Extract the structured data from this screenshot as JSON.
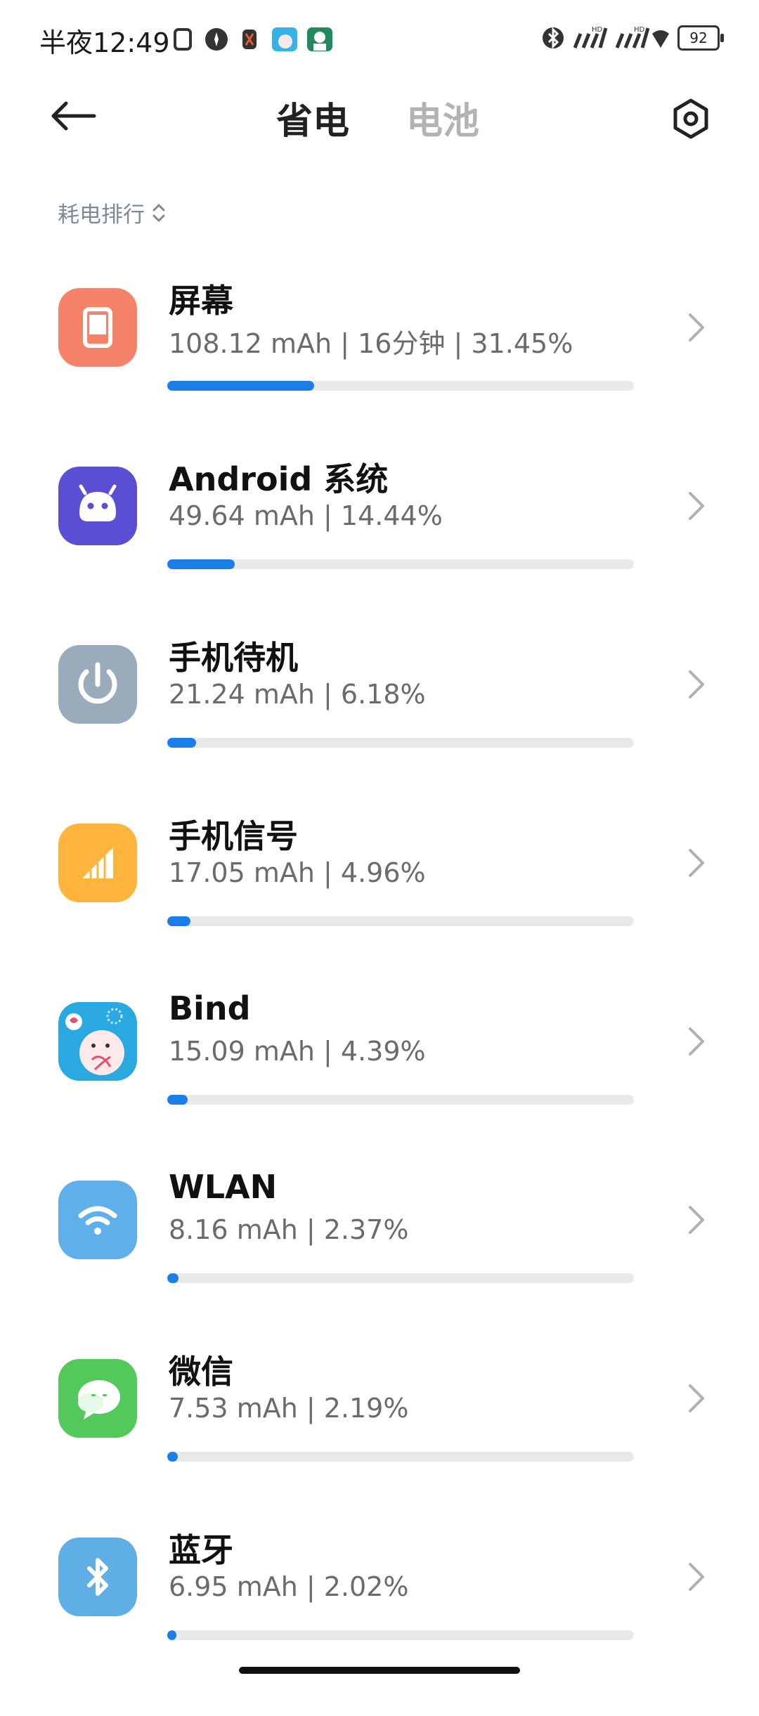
{
  "status_bar": {
    "time": "半夜12:49",
    "battery": "92"
  },
  "header": {
    "tab_active": "省电",
    "tab_inactive": "电池",
    "icons": [
      "back-arrow-icon",
      "settings-hexagon-icon"
    ]
  },
  "sort": {
    "label": "耗电排行"
  },
  "colors": {
    "progress_fill": "#1b7de8",
    "progress_track": "#e9e9e9",
    "tab_inactive": "#b3b3b3",
    "sort_label": "#7d8a9a"
  },
  "items": [
    {
      "title": "屏幕",
      "stats": "108.12 mAh | 16分钟 | 31.45%",
      "percent": 31.45,
      "icon": "screen-icon",
      "icon_color": "#f5836a"
    },
    {
      "title": "Android 系统",
      "stats": "49.64 mAh | 14.44%",
      "percent": 14.44,
      "icon": "android-icon",
      "icon_color": "#5a4fd3"
    },
    {
      "title": "手机待机",
      "stats": "21.24 mAh | 6.18%",
      "percent": 6.18,
      "icon": "power-icon",
      "icon_color": "#9aabbb"
    },
    {
      "title": "手机信号",
      "stats": "17.05 mAh | 4.96%",
      "percent": 4.96,
      "icon": "signal-icon",
      "icon_color": "#ffb43e"
    },
    {
      "title": "Bind",
      "stats": "15.09 mAh | 4.39%",
      "percent": 4.39,
      "icon": "bind-app-icon",
      "icon_color": "#2aa8e0"
    },
    {
      "title": "WLAN",
      "stats": "8.16 mAh | 2.37%",
      "percent": 2.37,
      "icon": "wifi-icon",
      "icon_color": "#5fb0ea"
    },
    {
      "title": "微信",
      "stats": "7.53 mAh | 2.19%",
      "percent": 2.19,
      "icon": "wechat-icon",
      "icon_color": "#52c95a"
    },
    {
      "title": "蓝牙",
      "stats": "6.95 mAh | 2.02%",
      "percent": 2.02,
      "icon": "bluetooth-icon",
      "icon_color": "#5faee6"
    }
  ]
}
